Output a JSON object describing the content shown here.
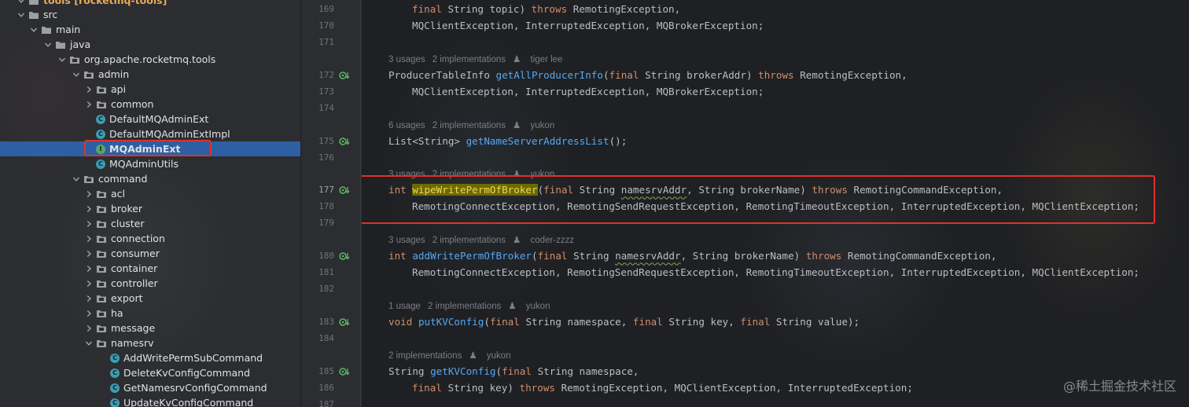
{
  "tree": {
    "root_label": "tools [rocketmq-tools]",
    "items": [
      {
        "label": "src",
        "kind": "folder",
        "expanded": true
      },
      {
        "label": "main",
        "kind": "folder",
        "expanded": true
      },
      {
        "label": "java",
        "kind": "folder",
        "expanded": true
      },
      {
        "label": "org.apache.rocketmq.tools",
        "kind": "package",
        "expanded": true
      },
      {
        "label": "admin",
        "kind": "package",
        "expanded": true
      },
      {
        "label": "api",
        "kind": "package",
        "expanded": false
      },
      {
        "label": "common",
        "kind": "package",
        "expanded": false
      },
      {
        "label": "DefaultMQAdminExt",
        "kind": "class"
      },
      {
        "label": "DefaultMQAdminExtImpl",
        "kind": "class"
      },
      {
        "label": "MQAdminExt",
        "kind": "interface",
        "selected": true
      },
      {
        "label": "MQAdminUtils",
        "kind": "class"
      },
      {
        "label": "command",
        "kind": "package",
        "expanded": true
      },
      {
        "label": "acl",
        "kind": "package",
        "expanded": false
      },
      {
        "label": "broker",
        "kind": "package",
        "expanded": false
      },
      {
        "label": "cluster",
        "kind": "package",
        "expanded": false
      },
      {
        "label": "connection",
        "kind": "package",
        "expanded": false
      },
      {
        "label": "consumer",
        "kind": "package",
        "expanded": false
      },
      {
        "label": "container",
        "kind": "package",
        "expanded": false
      },
      {
        "label": "controller",
        "kind": "package",
        "expanded": false
      },
      {
        "label": "export",
        "kind": "package",
        "expanded": false
      },
      {
        "label": "ha",
        "kind": "package",
        "expanded": false
      },
      {
        "label": "message",
        "kind": "package",
        "expanded": false
      },
      {
        "label": "namesrv",
        "kind": "package",
        "expanded": true
      },
      {
        "label": "AddWritePermSubCommand",
        "kind": "class"
      },
      {
        "label": "DeleteKvConfigCommand",
        "kind": "class"
      },
      {
        "label": "GetNamesrvConfigCommand",
        "kind": "class"
      },
      {
        "label": "UpdateKvConfigCommand",
        "kind": "class"
      }
    ]
  },
  "gutter": {
    "lines": [
      "169",
      "170",
      "171",
      "172",
      "173",
      "174",
      "175",
      "176",
      "177",
      "178",
      "179",
      "180",
      "181",
      "182",
      "183",
      "184",
      "185",
      "186",
      "187"
    ],
    "implementation_marker": "implementation-gutter-icon"
  },
  "editor": {
    "line169": {
      "kw": "final",
      "type": " String topic) ",
      "throws": "throws",
      "rest": " RemotingException,"
    },
    "line170": "MQClientException, InterruptedException, MQBrokerException;",
    "hint172": {
      "usages": "3 usages",
      "impl": "2 implementations",
      "author": "tiger lee"
    },
    "line172": {
      "ret": "ProducerTableInfo ",
      "name": "getAllProducerInfo",
      "open": "(",
      "kw": "final",
      "params": " String brokerAddr) ",
      "throws": "throws",
      "rest": " RemotingException,"
    },
    "line173": "MQClientException, InterruptedException, MQBrokerException;",
    "hint175": {
      "usages": "6 usages",
      "impl": "2 implementations",
      "author": "yukon"
    },
    "line175": {
      "ret": "List<String> ",
      "name": "getNameServerAddressList",
      "rest": "();"
    },
    "hint177": {
      "usages": "3 usages",
      "impl": "2 implementations",
      "author": "yukon"
    },
    "line177": {
      "ret": "int",
      "name": "wipeWritePermOfBroker",
      "open": "(",
      "kw": "final",
      "p1": " String ",
      "p1name": "namesrvAddr",
      "p2": ", String brokerName) ",
      "throws": "throws",
      "rest": " RemotingCommandException,"
    },
    "line178": "RemotingConnectException, RemotingSendRequestException, RemotingTimeoutException, InterruptedException, MQClientException;",
    "hint180": {
      "usages": "3 usages",
      "impl": "2 implementations",
      "author": "coder-zzzz"
    },
    "line180": {
      "ret": "int",
      "name": "addWritePermOfBroker",
      "open": "(",
      "kw": "final",
      "p1": " String ",
      "p1name": "namesrvAddr",
      "p2": ", String brokerName) ",
      "throws": "throws",
      "rest": " RemotingCommandException,"
    },
    "line181": "RemotingConnectException, RemotingSendRequestException, RemotingTimeoutException, InterruptedException, MQClientException;",
    "hint183": {
      "usages": "1 usage",
      "impl": "2 implementations",
      "author": "yukon"
    },
    "line183": {
      "ret": "void",
      "name": "putKVConfig",
      "open": "(",
      "kw1": "final",
      "p1": " String namespace, ",
      "kw2": "final",
      "p2": " String key, ",
      "kw3": "final",
      "p3": " String value);"
    },
    "hint185": {
      "impl": "2 implementations",
      "author": "yukon"
    },
    "line185": {
      "ret": "String ",
      "name": "getKVConfig",
      "open": "(",
      "kw": "final",
      "p1": " String namespace,"
    },
    "line186": {
      "kw": "final",
      "p1": " String key) ",
      "throws": "throws",
      "rest": " RemotingException, MQClientException, InterruptedException;"
    }
  },
  "watermark": "@稀土掘金技术社区",
  "colors": {
    "keyword": "#cf8e6d",
    "method": "#56a8f5",
    "selection": "#2e5fa3",
    "annotation_box": "#e2302a",
    "highlight": "#6b6b00"
  }
}
